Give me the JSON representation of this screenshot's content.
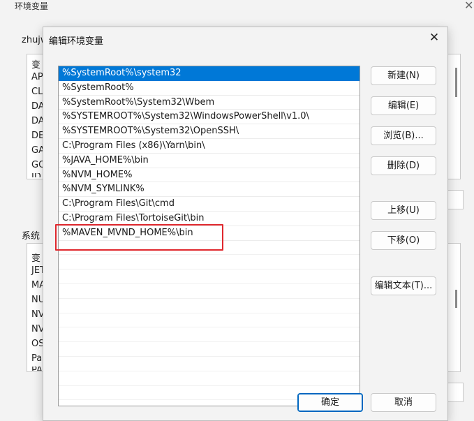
{
  "parent_window": {
    "title": "环境变量",
    "user_vars_label": "zhujw",
    "user_var_rows": [
      "变",
      "AP",
      "CL",
      "DA",
      "DA",
      "DE",
      "GA",
      "GO",
      "ID"
    ],
    "system_vars_label": "系统",
    "system_var_rows": [
      "变",
      "JET",
      "MA",
      "NU",
      "NV",
      "NV",
      "OS",
      "Pa",
      "PA"
    ]
  },
  "dialog": {
    "title": "编辑环境变量",
    "entries": [
      "%SystemRoot%\\system32",
      "%SystemRoot%",
      "%SystemRoot%\\System32\\Wbem",
      "%SYSTEMROOT%\\System32\\WindowsPowerShell\\v1.0\\",
      "%SYSTEMROOT%\\System32\\OpenSSH\\",
      "C:\\Program Files (x86)\\Yarn\\bin\\",
      "%JAVA_HOME%\\bin",
      "%NVM_HOME%",
      "%NVM_SYMLINK%",
      "C:\\Program Files\\Git\\cmd",
      "C:\\Program Files\\TortoiseGit\\bin",
      "%MAVEN_MVND_HOME%\\bin"
    ],
    "selected_index": 0,
    "buttons": {
      "new": "新建(N)",
      "edit": "编辑(E)",
      "browse": "浏览(B)...",
      "delete": "删除(D)",
      "move_up": "上移(U)",
      "move_down": "下移(O)",
      "edit_text": "编辑文本(T)...",
      "ok": "确定",
      "cancel": "取消"
    }
  },
  "colors": {
    "selection": "#0078d7",
    "annotation": "#e0282e",
    "primary_border": "#0067c0"
  }
}
